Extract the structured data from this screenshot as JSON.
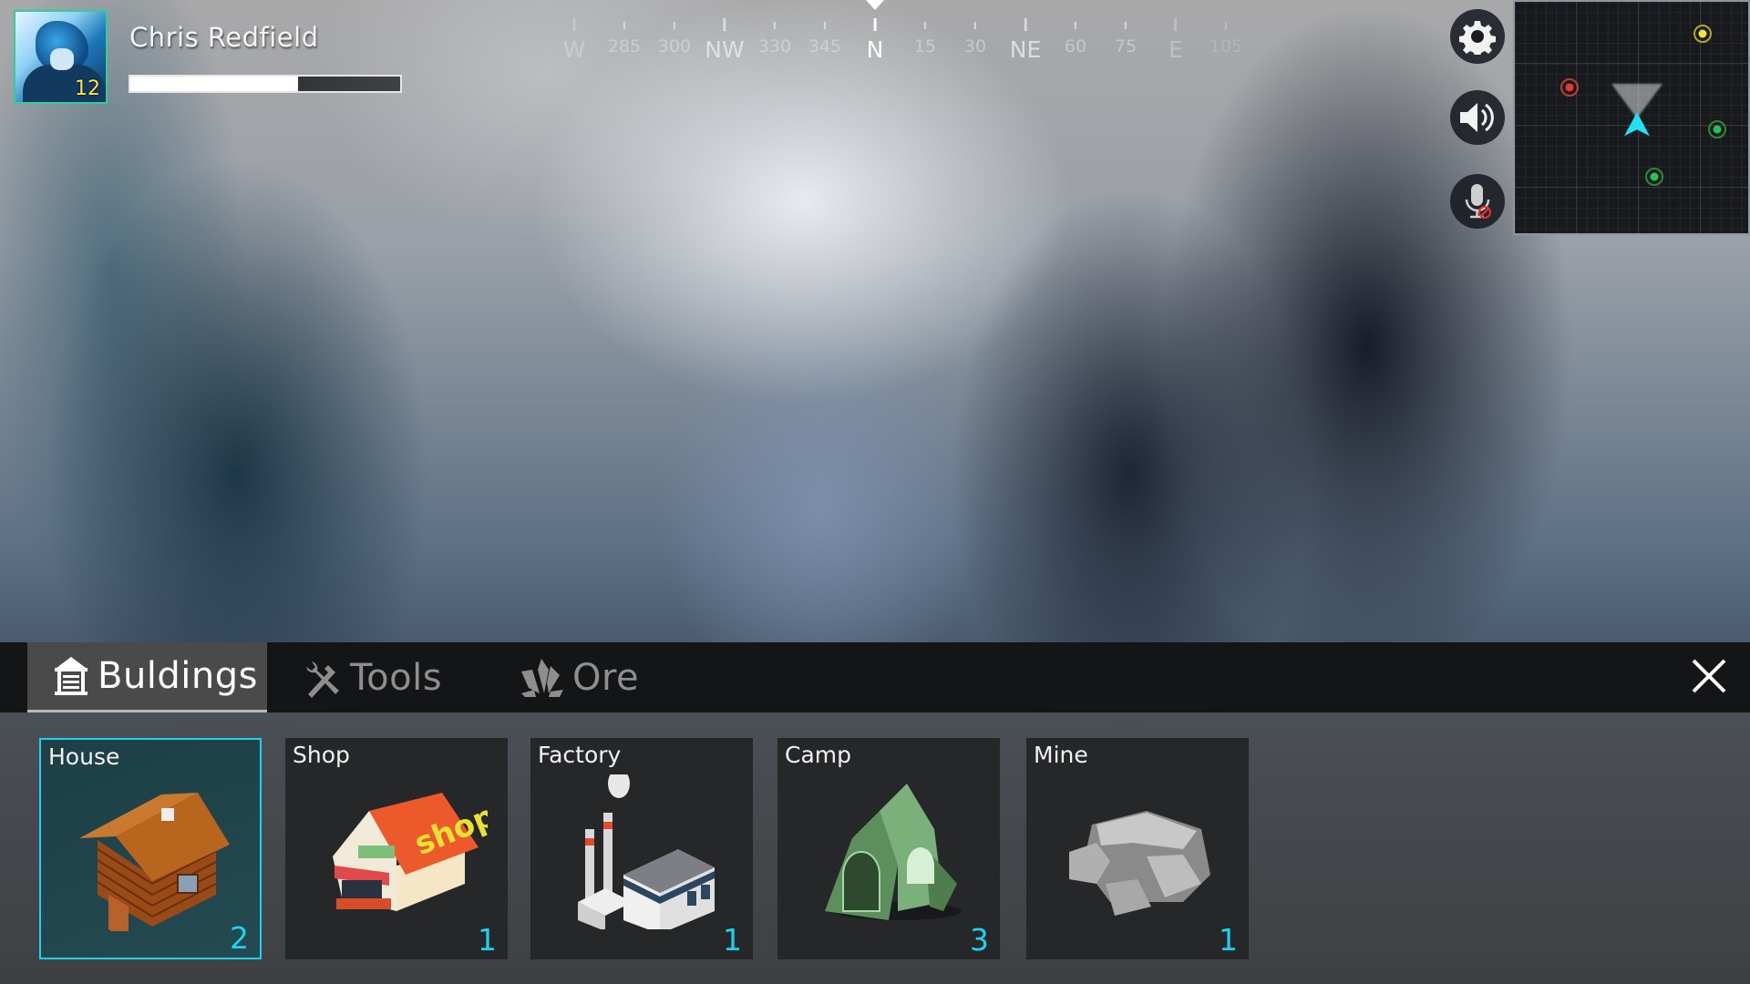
{
  "player": {
    "name": "Chris Redfield",
    "level": "12",
    "xp_progress_percent": 62,
    "avatar_icon": "anime-character-portrait"
  },
  "compass": {
    "heading": "N",
    "marks": [
      {
        "label": "W",
        "major": true
      },
      {
        "label": "285",
        "major": false
      },
      {
        "label": "300",
        "major": false
      },
      {
        "label": "NW",
        "major": true
      },
      {
        "label": "330",
        "major": false
      },
      {
        "label": "345",
        "major": false
      },
      {
        "label": "N",
        "major": true,
        "center": true
      },
      {
        "label": "15",
        "major": false
      },
      {
        "label": "30",
        "major": false
      },
      {
        "label": "NE",
        "major": true
      },
      {
        "label": "60",
        "major": false
      },
      {
        "label": "75",
        "major": false
      },
      {
        "label": "E",
        "major": true
      },
      {
        "label": "105",
        "major": false
      }
    ]
  },
  "controls": [
    {
      "name": "settings",
      "icon": "gear-icon"
    },
    {
      "name": "sound",
      "icon": "speaker-icon"
    },
    {
      "name": "microphone-muted",
      "icon": "microphone-muted-icon"
    }
  ],
  "minimap": {
    "markers": [
      {
        "type": "objective",
        "color": "#f5e234",
        "ring": "#b6a822"
      },
      {
        "type": "enemy",
        "color": "#e23a30",
        "ring": "#b8402f"
      },
      {
        "type": "ally",
        "color": "#27c15a",
        "ring": "#2a8a36"
      },
      {
        "type": "ally",
        "color": "#27c15a",
        "ring": "#2a8a36"
      }
    ],
    "player_color": "#1fe3f5"
  },
  "panel": {
    "tabs": [
      {
        "label": "Buldings",
        "icon": "building-icon",
        "active": true
      },
      {
        "label": "Tools",
        "icon": "tools-icon",
        "active": false
      },
      {
        "label": "Ore",
        "icon": "crystal-ore-icon",
        "active": false
      }
    ],
    "close_label": "close",
    "accent_color": "#19d3f0",
    "items": [
      {
        "name": "House",
        "count": "2",
        "selected": true
      },
      {
        "name": "Shop",
        "count": "1",
        "selected": false
      },
      {
        "name": "Factory",
        "count": "1",
        "selected": false
      },
      {
        "name": "Camp",
        "count": "3",
        "selected": false
      },
      {
        "name": "Mine",
        "count": "1",
        "selected": false
      }
    ]
  }
}
